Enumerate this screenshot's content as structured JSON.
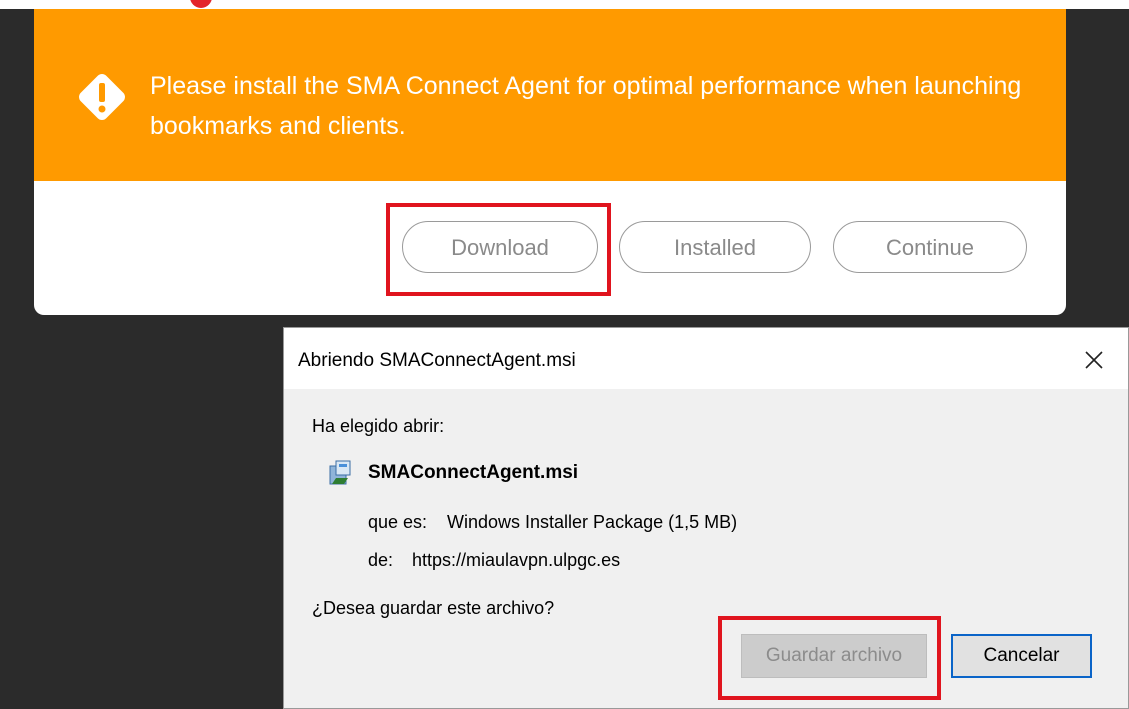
{
  "notice": {
    "message": "Please install the SMA Connect Agent for optimal performance when launching bookmarks and clients.",
    "buttons": {
      "download": "Download",
      "installed": "Installed",
      "continue": "Continue"
    },
    "banner_color": "#ff9a00"
  },
  "dialog": {
    "title": "Abriendo SMAConnectAgent.msi",
    "chosen_label": "Ha elegido abrir:",
    "file_name": "SMAConnectAgent.msi",
    "type_label": "que es:",
    "type_value": "Windows Installer Package (1,5 MB)",
    "from_label": "de:",
    "from_value": "https://miaulavpn.ulpgc.es",
    "question": "¿Desea guardar este archivo?",
    "save_label": "Guardar archivo",
    "cancel_label": "Cancelar"
  },
  "icons": {
    "warning": "warning-diamond-icon",
    "file": "installer-package-icon",
    "close": "close-icon"
  },
  "highlight_color": "#e0141e"
}
